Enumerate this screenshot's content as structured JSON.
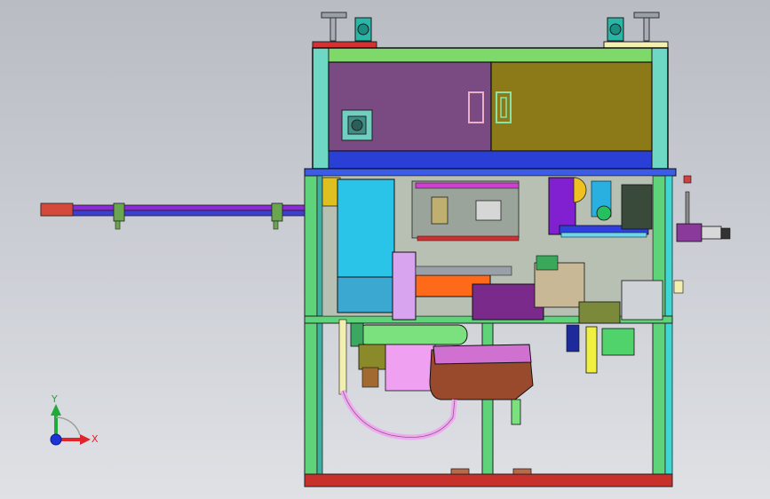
{
  "viewport": {
    "background_top": "#b9bcc3",
    "background_bottom": "#dfe1e5"
  },
  "triad": {
    "x_label": "X",
    "y_label": "Y",
    "x_color": "#e0242b",
    "y_color": "#1faa3a",
    "z_color": "#1c33d6"
  },
  "palette": {
    "frame_green": "#5fd37a",
    "frame_cyan": "#3fd6d6",
    "top_panel_purple": "#7a4a82",
    "top_panel_olive": "#8c7a18",
    "beam_blue": "#2a3fd6",
    "base_red": "#c8302c",
    "cyan_block": "#29c4e8",
    "violet_block": "#d8a4f0",
    "orange_bar": "#ff6a1a",
    "lime_cylinder": "#7be07e",
    "copper_housing": "#9a4a2c",
    "magenta_top": "#d070d0",
    "pink_hose": "#f0a8f0",
    "conveyor_blue": "#3c3fd0",
    "conveyor_purple": "#8a2ad8"
  }
}
